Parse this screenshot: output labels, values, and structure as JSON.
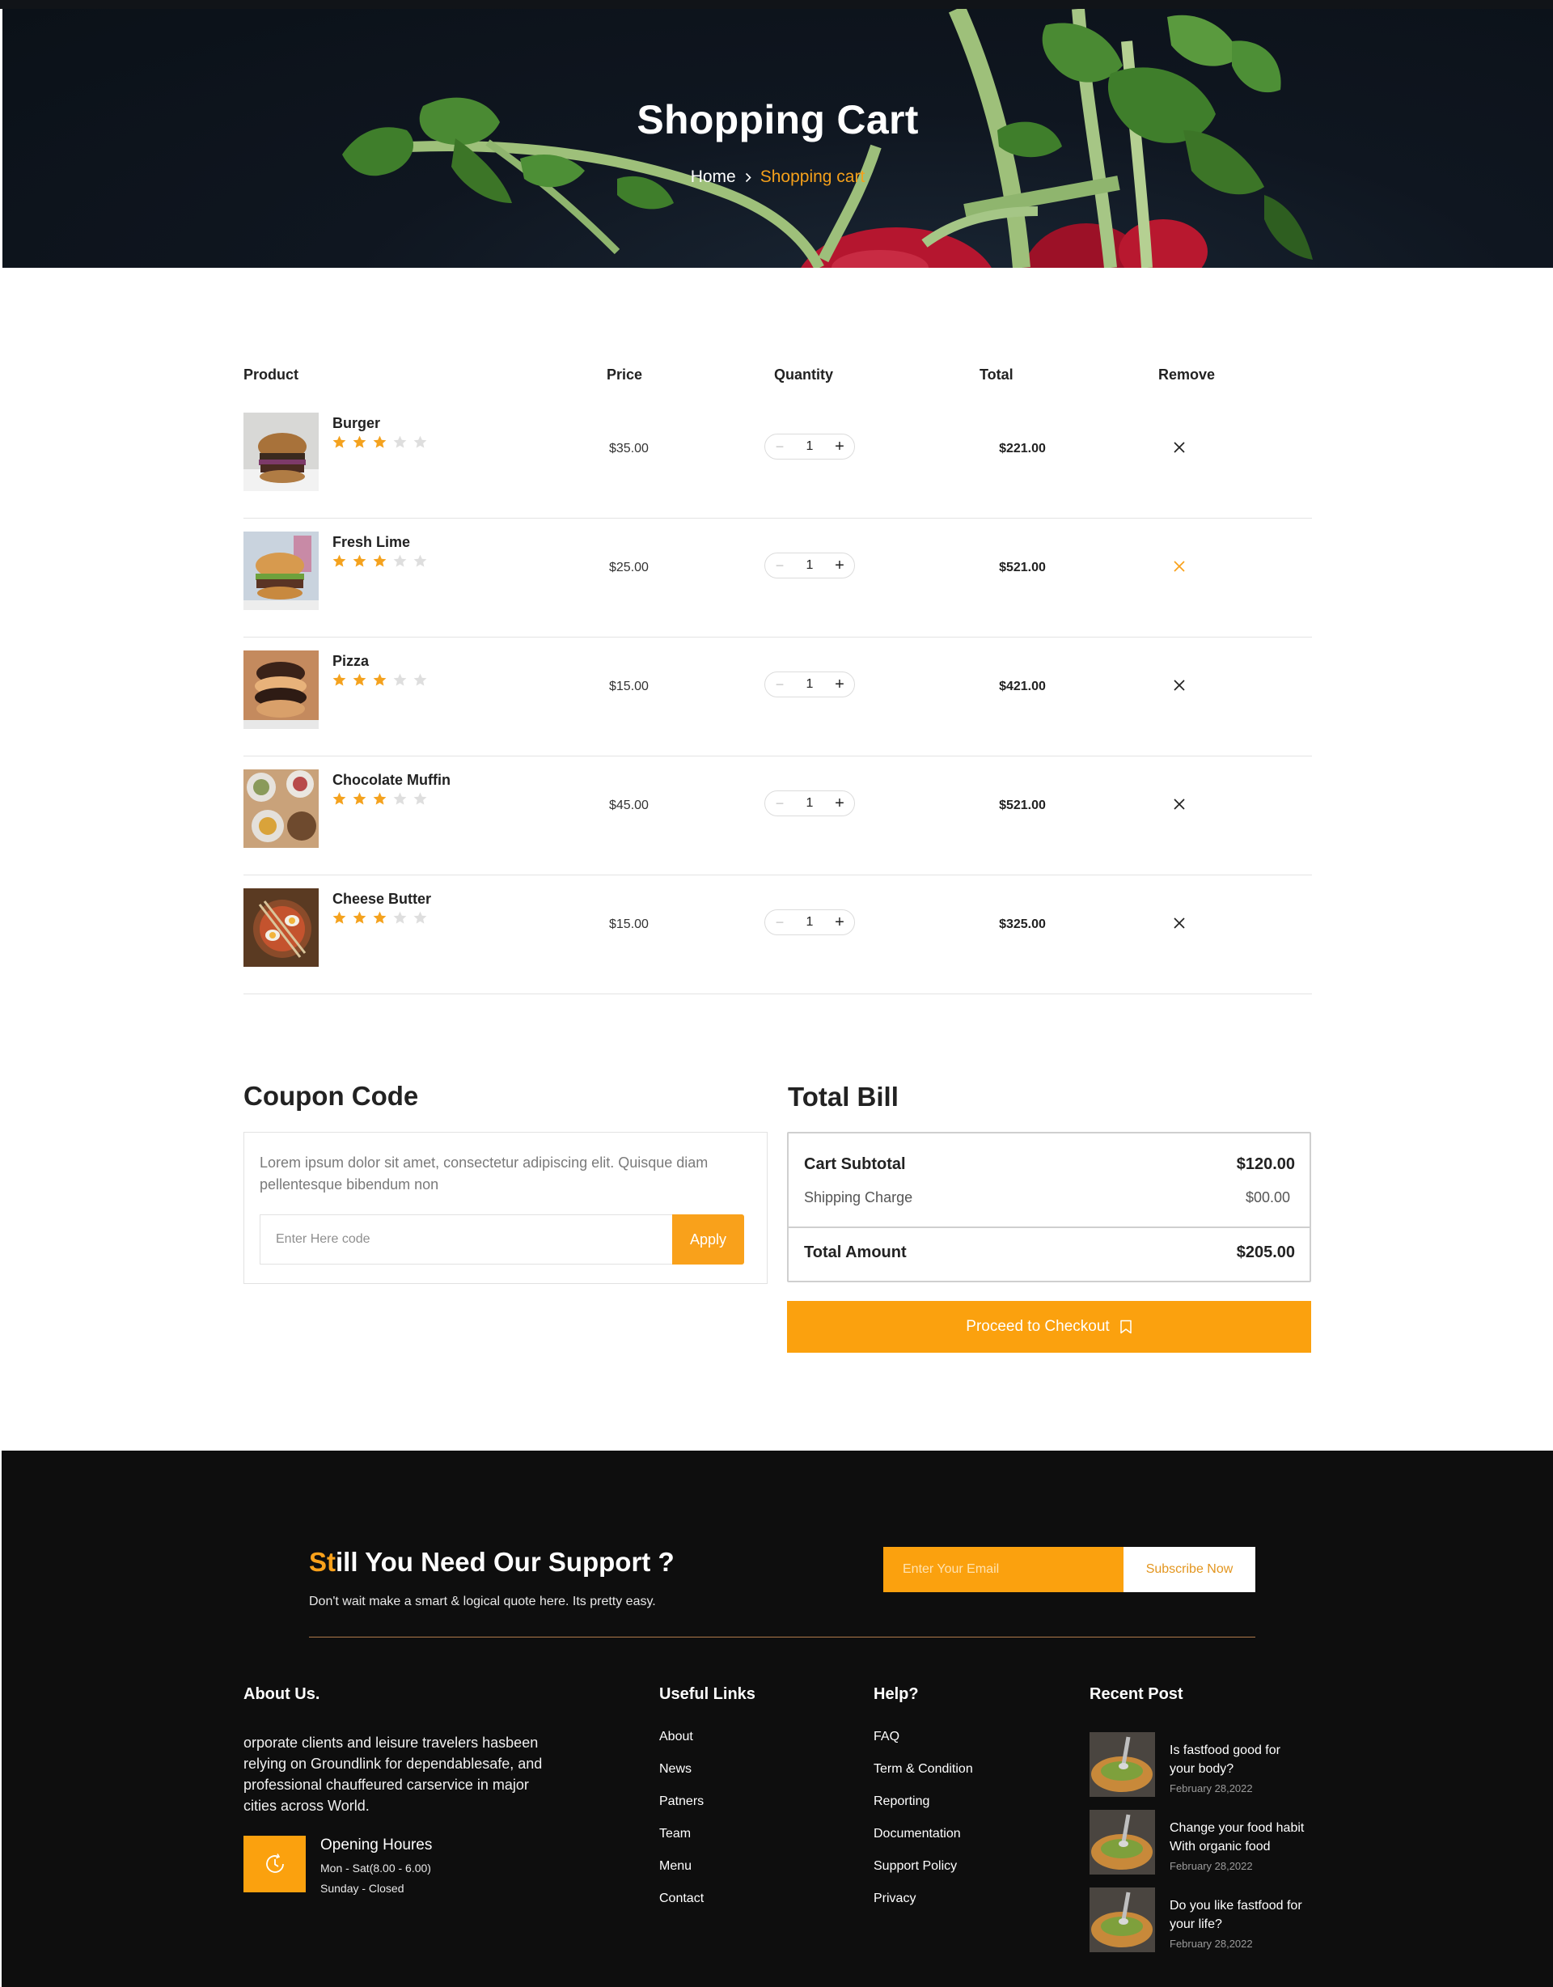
{
  "hero": {
    "title": "Shopping Cart",
    "breadcrumb": {
      "home": "Home",
      "current": "Shopping cart"
    }
  },
  "cart": {
    "headers": {
      "product": "Product",
      "price": "Price",
      "quantity": "Quantity",
      "total": "Total",
      "remove": "Remove"
    },
    "items": [
      {
        "name": "Burger",
        "rating": 3,
        "max_rating": 5,
        "price": "$35.00",
        "qty": "1",
        "total": "$221.00",
        "remove_highlight": false
      },
      {
        "name": "Fresh Lime",
        "rating": 3,
        "max_rating": 5,
        "price": "$25.00",
        "qty": "1",
        "total": "$521.00",
        "remove_highlight": true
      },
      {
        "name": "Pizza",
        "rating": 3,
        "max_rating": 5,
        "price": "$15.00",
        "qty": "1",
        "total": "$421.00",
        "remove_highlight": false
      },
      {
        "name": "Chocolate Muffin",
        "rating": 3,
        "max_rating": 5,
        "price": "$45.00",
        "qty": "1",
        "total": "$521.00",
        "remove_highlight": false
      },
      {
        "name": "Cheese Butter",
        "rating": 3,
        "max_rating": 5,
        "price": "$15.00",
        "qty": "1",
        "total": "$325.00",
        "remove_highlight": false
      }
    ],
    "qty_minus": "−",
    "qty_plus": "+"
  },
  "coupon": {
    "title": "Coupon Code",
    "description": "Lorem ipsum dolor sit amet, consectetur adipiscing elit. Quisque diam pellentesque bibendum non",
    "input_placeholder": "Enter Here code",
    "apply_label": "Apply"
  },
  "bill": {
    "title": "Total Bill",
    "subtotal_label": "Cart Subtotal",
    "subtotal_value": "$120.00",
    "shipping_label": "Shipping Charge",
    "shipping_value": "$00.00",
    "total_label": "Total Amount",
    "total_value": "$205.00",
    "checkout_label": "Proceed to Checkout"
  },
  "footer": {
    "support": {
      "title_accent": "St",
      "title_rest": "ill You Need Our Support ?",
      "subtitle": "Don't wait make a smart & logical quote here. Its pretty easy.",
      "email_placeholder": "Enter Your Email",
      "subscribe_label": "Subscribe Now"
    },
    "about": {
      "heading": "About Us.",
      "text": "orporate clients and leisure travelers hasbeen relying on Groundlink for dependablesafe, and professional chauffeured carservice in major cities across World.",
      "hours_title": "Opening Houres",
      "hours_weekdays": "Mon - Sat(8.00 - 6.00)",
      "hours_sunday": "Sunday - Closed"
    },
    "useful_links": {
      "heading": "Useful Links",
      "items": [
        "About",
        "News",
        "Patners",
        "Team",
        "Menu",
        "Contact"
      ]
    },
    "help": {
      "heading": "Help?",
      "items": [
        "FAQ",
        "Term & Condition",
        "Reporting",
        "Documentation",
        "Support Policy",
        "Privacy"
      ]
    },
    "recent_posts": {
      "heading": "Recent Post",
      "items": [
        {
          "title": "Is fastfood good for your body?",
          "date": "February 28,2022"
        },
        {
          "title": "Change your food habit With organic food",
          "date": "February 28,2022"
        },
        {
          "title": "Do you like fastfood for your life?",
          "date": "February 28,2022"
        }
      ]
    }
  },
  "colors": {
    "accent": "#f9a11b",
    "hero_bg": "#0f1620",
    "footer_bg": "#0e0e0e",
    "star_on": "#f4a21e",
    "star_off": "#dedede"
  },
  "icons": {
    "breadcrumb_sep": "chevron-right-icon",
    "remove": "close-icon",
    "checkout": "bookmark-icon",
    "hours": "clock-icon",
    "rating": "star-icon"
  }
}
